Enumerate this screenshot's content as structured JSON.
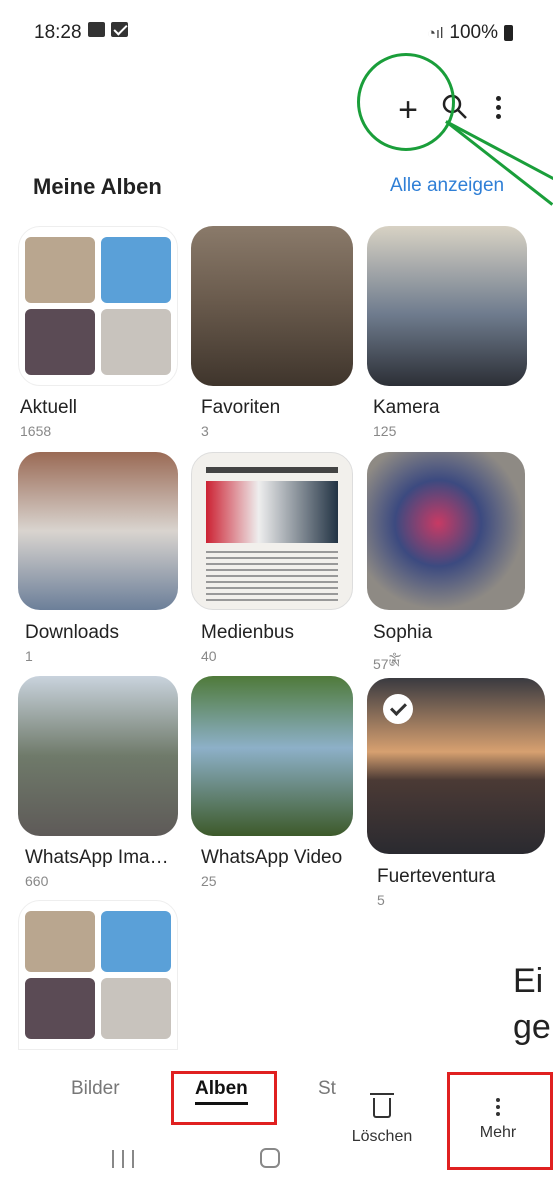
{
  "status": {
    "time": "18:28",
    "battery": "100%"
  },
  "header": {
    "section_title": "Meine Alben",
    "see_all_label": "Alle anzeigen"
  },
  "albums": [
    {
      "name": "Aktuell",
      "count": "1658"
    },
    {
      "name": "Favoriten",
      "count": "3"
    },
    {
      "name": "Kamera",
      "count": "125"
    },
    {
      "name": "Downloads",
      "count": "1"
    },
    {
      "name": "Medienbus",
      "count": "40"
    },
    {
      "name": "Sophia",
      "count": "57ༀ"
    },
    {
      "name": "WhatsApp Ima…",
      "count": "660"
    },
    {
      "name": "WhatsApp Video",
      "count": "25"
    },
    {
      "name": "Fuerteventura",
      "count": "5"
    }
  ],
  "bottom_tabs": {
    "pictures": "Bilder",
    "albums": "Alben",
    "stories_partial": "St"
  },
  "actions": {
    "delete": "Löschen",
    "more": "Mehr"
  },
  "overlay_text": {
    "line1": "Ei",
    "line2": "ge"
  },
  "colors": {
    "accent_link": "#2f7fd6",
    "annotation_green": "#1a9e3a",
    "annotation_red": "#e02020"
  }
}
